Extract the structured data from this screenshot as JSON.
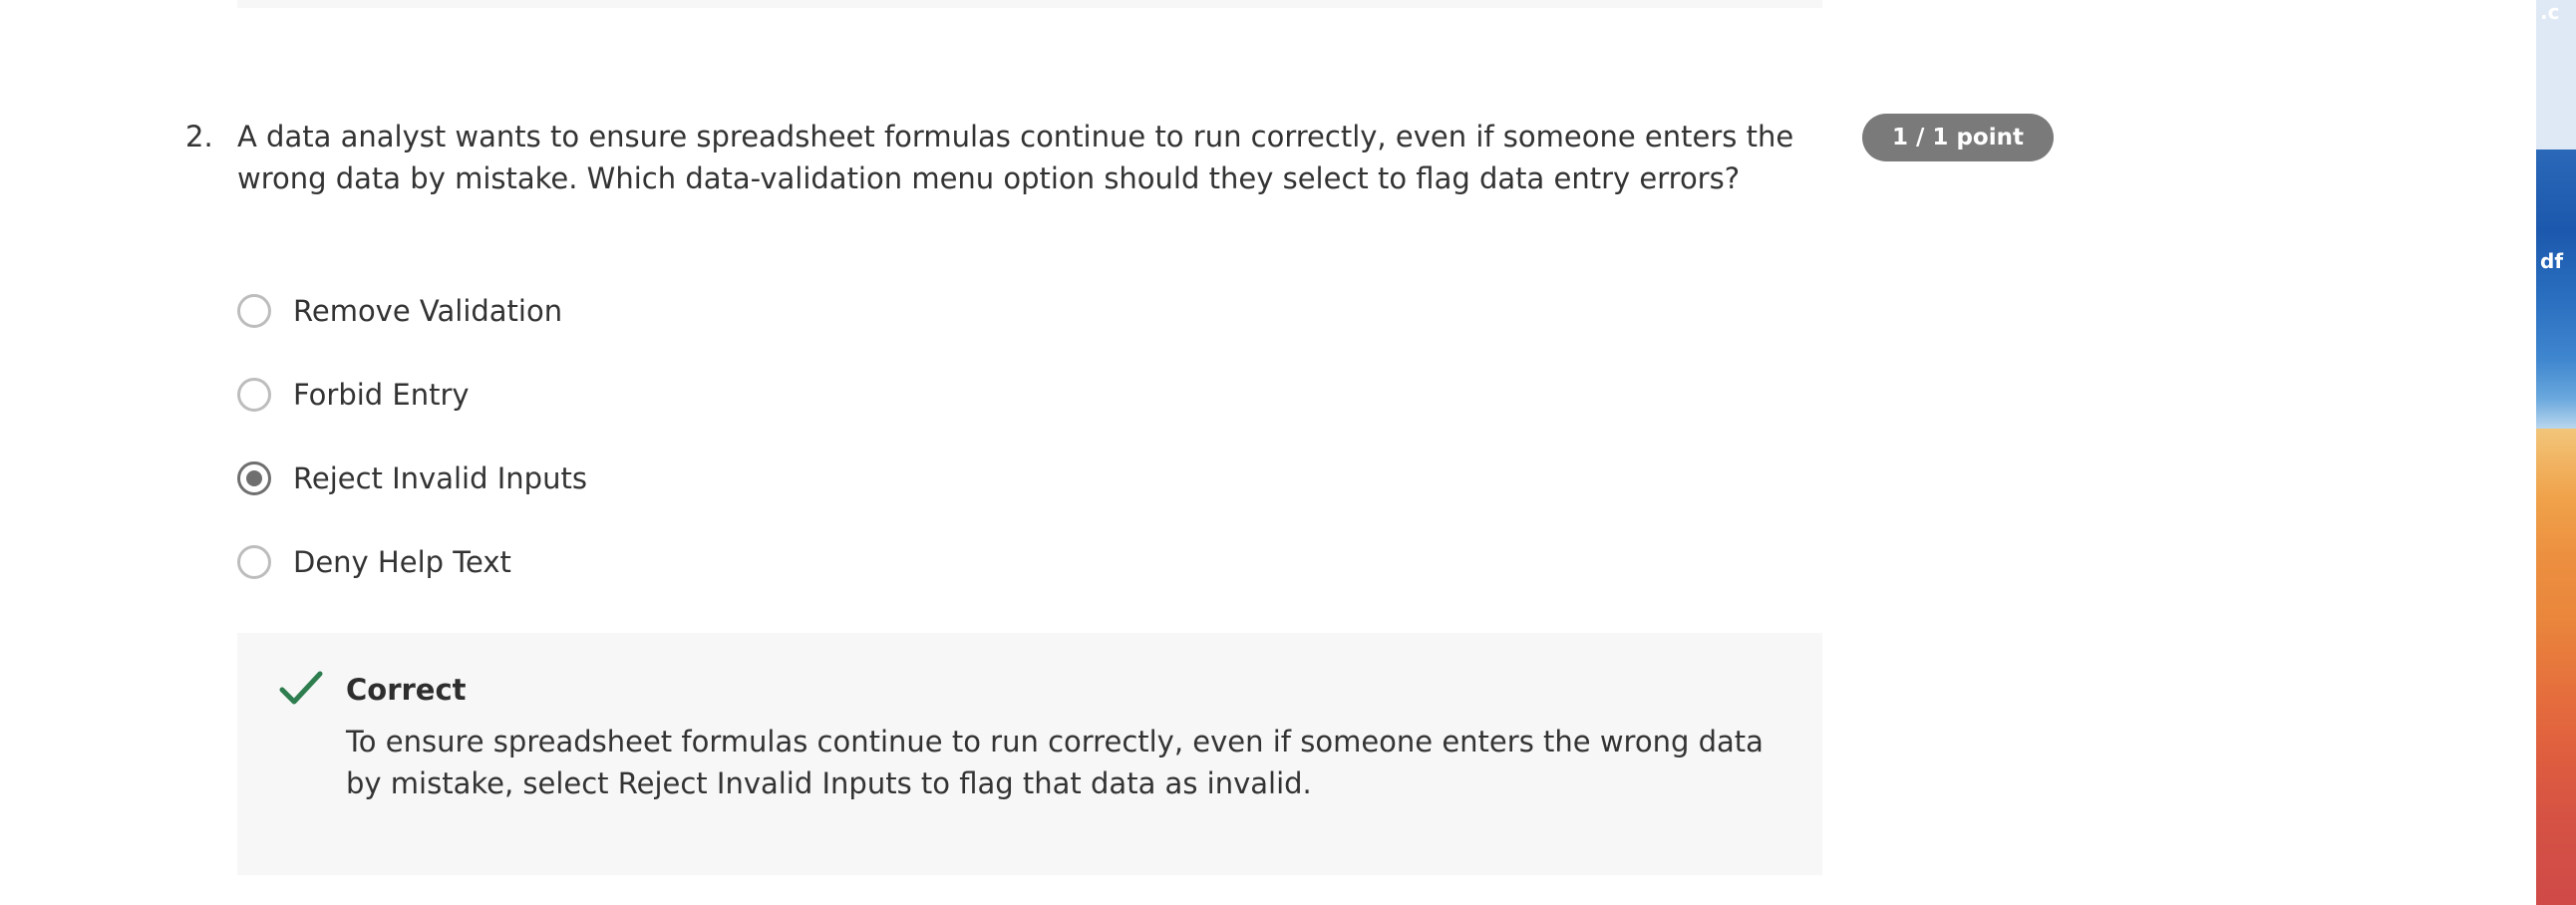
{
  "question": {
    "number": "2.",
    "text": "A data analyst wants to ensure spreadsheet formulas continue to run correctly, even if someone enters the wrong data by mistake. Which data-validation menu option should they select to flag data entry errors?",
    "points_badge": "1 / 1 point"
  },
  "options": [
    {
      "label": "Remove Validation",
      "selected": false
    },
    {
      "label": "Forbid Entry",
      "selected": false
    },
    {
      "label": "Reject Invalid Inputs",
      "selected": true
    },
    {
      "label": "Deny Help Text",
      "selected": false
    }
  ],
  "feedback": {
    "status": "Correct",
    "text": "To ensure spreadsheet formulas continue to run correctly, even if someone enters the wrong data by mistake, select Reject Invalid Inputs to flag that data as invalid.",
    "icon": "checkmark-icon",
    "color": "#2e7d4f"
  },
  "wallpaper": {
    "label_top": ".c",
    "label_mid": "df"
  }
}
